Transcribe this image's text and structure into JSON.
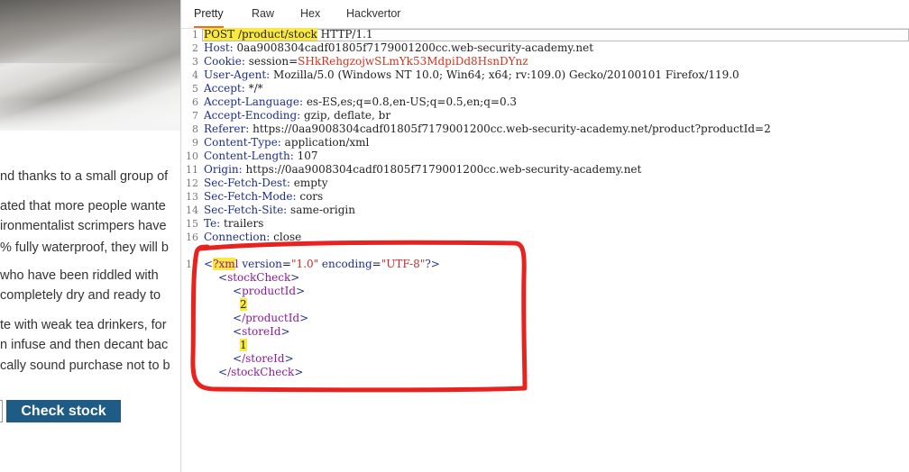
{
  "product": {
    "description_lines": [
      "nd thanks to a small group of",
      "ated that more people wante",
      "ironmentalist scrimpers have",
      "% fully waterproof, they will b",
      " who have been riddled with",
      " completely dry and ready to",
      "te with weak tea drinkers, for",
      "n infuse and then decant bac",
      "cally sound purchase not to b"
    ],
    "check_stock_label": "Check stock"
  },
  "editor": {
    "tabs": [
      "Pretty",
      "Raw",
      "Hex",
      "Hackvertor"
    ],
    "active_tab": "Pretty",
    "request_line": {
      "method_path": "POST /product/stock",
      "version": " HTTP/1.1"
    },
    "headers": [
      {
        "name": "Host:",
        "value": " 0aa9008304cadf01805f7179001200cc.web-security-academy.net"
      },
      {
        "name": "Cookie:",
        "value": " session=",
        "extra": "SHkRehgzojwSLmYk53MdpiDd8HsnDYnz"
      },
      {
        "name": "User-Agent:",
        "value": " Mozilla/5.0 (Windows NT 10.0; Win64; x64; rv:109.0) Gecko/20100101 Firefox/119.0"
      },
      {
        "name": "Accept:",
        "value": " */*"
      },
      {
        "name": "Accept-Language:",
        "value": " es-ES,es;q=0.8,en-US;q=0.5,en;q=0.3"
      },
      {
        "name": "Accept-Encoding:",
        "value": " gzip, deflate, br"
      },
      {
        "name": "Referer:",
        "value": " https://0aa9008304cadf01805f7179001200cc.web-security-academy.net/product?productId=2"
      },
      {
        "name": "Content-Type:",
        "value": " application/xml"
      },
      {
        "name": "Content-Length:",
        "value": " 107"
      },
      {
        "name": "Origin:",
        "value": " https://0aa9008304cadf01805f7179001200cc.web-security-academy.net"
      },
      {
        "name": "Sec-Fetch-Dest:",
        "value": " empty"
      },
      {
        "name": "Sec-Fetch-Mode:",
        "value": " cors"
      },
      {
        "name": "Sec-Fetch-Site:",
        "value": " same-origin"
      },
      {
        "name": "Te:",
        "value": " trailers"
      },
      {
        "name": "Connection:",
        "value": " close"
      }
    ],
    "line_numbers": [
      "1",
      "2",
      "3",
      "4",
      "5",
      "6",
      "7",
      "8",
      "9",
      "10",
      "11",
      "12",
      "13",
      "14",
      "15",
      "16",
      "17"
    ],
    "xml": {
      "open_bracket": "<",
      "pi_highlight": "?xm",
      "pi_rest": "l",
      "version_attr": "version",
      "version_val": "\"1.0\"",
      "encoding_attr": "encoding",
      "encoding_val": "\"UTF-8\"",
      "pi_close": "?>",
      "stock_check_open": "stockCheck",
      "product_id_open": "productId",
      "product_id_value": "2",
      "product_id_close": "/productId",
      "store_id_open": "storeId",
      "store_id_value": "1",
      "store_id_close": "/storeId",
      "stock_check_close": "/stockCheck",
      "lt": "<",
      "gt": ">"
    },
    "colors": {
      "highlight": "#fbe93e",
      "annotation": "#e8231f",
      "tab_underline": "#f26b21",
      "button": "#1f5c85"
    }
  }
}
